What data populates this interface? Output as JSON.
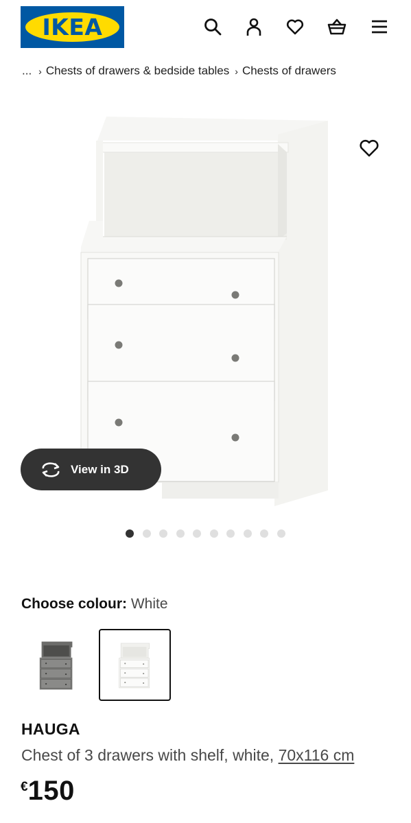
{
  "header": {
    "logo_text": "IKEA",
    "icons": [
      "search-icon",
      "user-icon",
      "heart-icon",
      "basket-icon",
      "menu-icon"
    ],
    "colors": {
      "brand_blue": "#0058a3",
      "brand_yellow": "#ffdb00"
    }
  },
  "breadcrumb": {
    "ellipsis": "...",
    "items": [
      "Chests of drawers & bedside tables",
      "Chests of drawers"
    ]
  },
  "gallery": {
    "view3d_label": "View in 3D",
    "slide_count": 10,
    "active_slide": 1,
    "favourite_icon": "heart-icon"
  },
  "colour": {
    "label": "Choose colour:",
    "selected": "White",
    "options": [
      "grey",
      "white"
    ]
  },
  "product": {
    "name": "HAUGA",
    "description": "Chest of 3 drawers with shelf, white, ",
    "size_link": "70x116 cm",
    "currency": "€",
    "price": "150"
  }
}
